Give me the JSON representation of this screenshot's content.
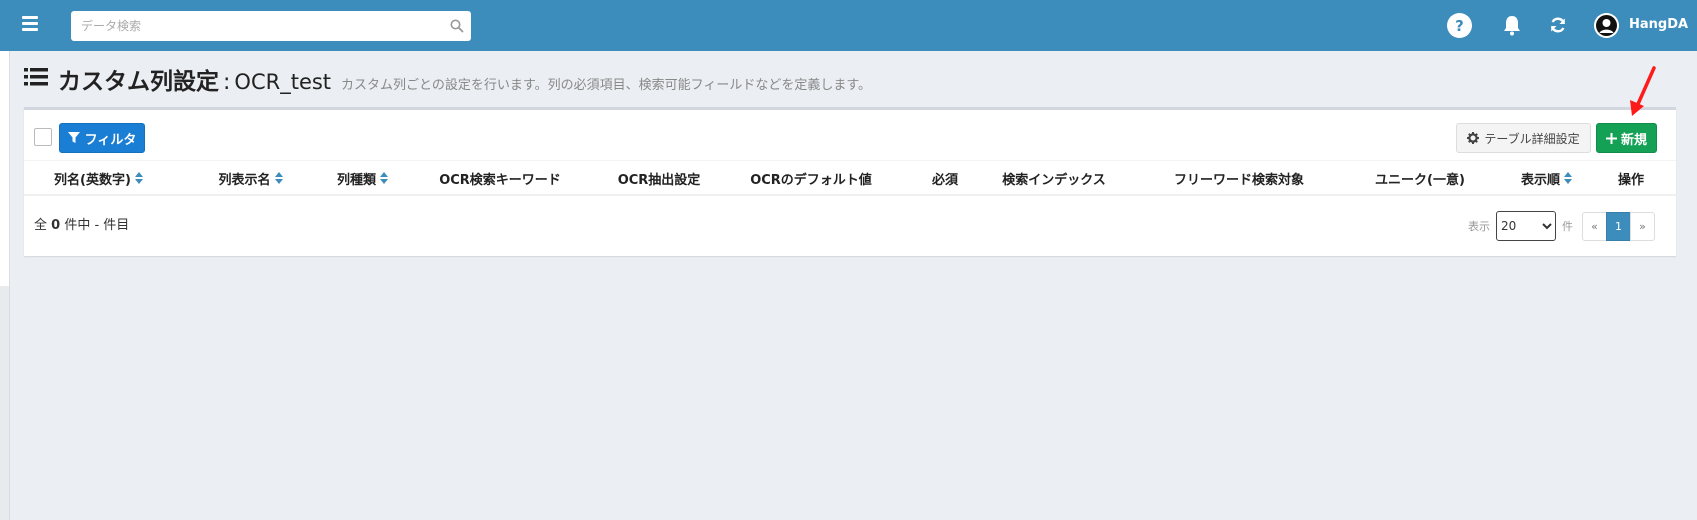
{
  "topbar": {
    "search_placeholder": "データ検索",
    "help_label": "?",
    "username": "HangDA",
    "bar_color": "#3c8dbc"
  },
  "header": {
    "title": "カスタム列設定",
    "separator": ":",
    "table_name": "OCR_test",
    "description": "カスタム列ごとの設定を行います。列の必須項目、検索可能フィールドなどを定義します。"
  },
  "toolbar": {
    "filter_label": "フィルタ",
    "settings_label": "テーブル詳細設定",
    "new_label": "新規",
    "new_color": "#14a155",
    "filter_color": "#1a7fd4"
  },
  "table": {
    "columns": [
      {
        "label": "列名(英数字)",
        "sortable": true
      },
      {
        "label": "列表示名",
        "sortable": true
      },
      {
        "label": "列種類",
        "sortable": true
      },
      {
        "label": "OCR検索キーワード",
        "sortable": false
      },
      {
        "label": "OCR抽出設定",
        "sortable": false
      },
      {
        "label": "OCRのデフォルト値",
        "sortable": false
      },
      {
        "label": "必須",
        "sortable": false
      },
      {
        "label": "検索インデックス",
        "sortable": false
      },
      {
        "label": "フリーワード検索対象",
        "sortable": false
      },
      {
        "label": "ユニーク(一意)",
        "sortable": false
      },
      {
        "label": "表示順",
        "sortable": true
      },
      {
        "label": "操作",
        "sortable": false
      }
    ]
  },
  "footer": {
    "count_prefix": "全",
    "count_value": "0",
    "count_suffix": "件中 - 件目",
    "display_label": "表示",
    "page_size": "20",
    "unit_label": "件",
    "prev_label": "«",
    "current_page": "1",
    "next_label": "»"
  }
}
